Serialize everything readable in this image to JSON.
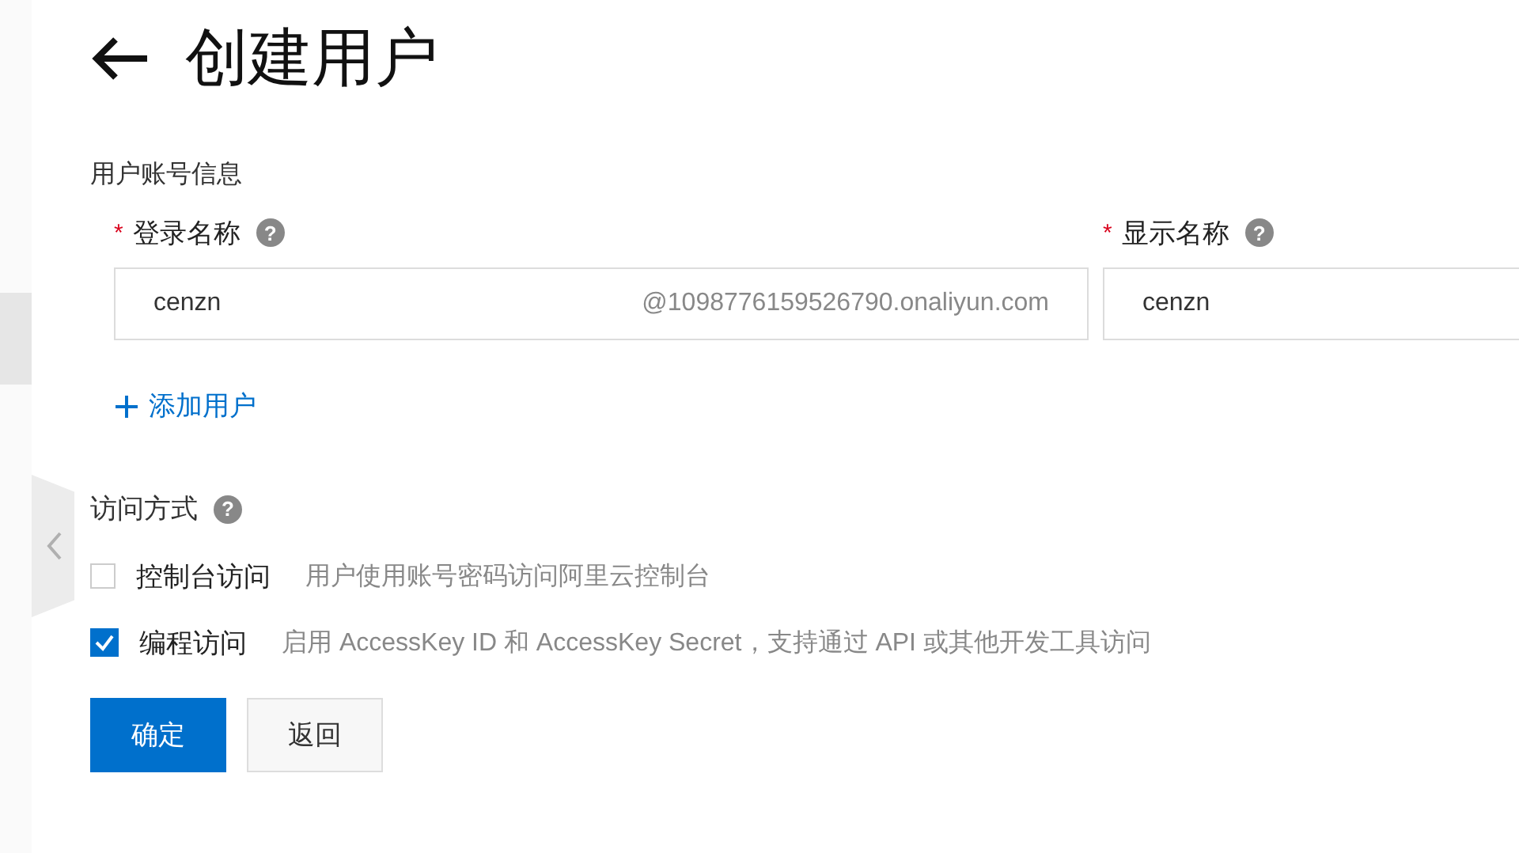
{
  "title": "创建用户",
  "account_section": {
    "heading": "用户账号信息",
    "fields": [
      {
        "required_mark": "*",
        "label": "登录名称",
        "help": "?",
        "value": "cenzn",
        "suffix": "@1098776159526790.onaliyun.com"
      },
      {
        "required_mark": "*",
        "label": "显示名称",
        "help": "?",
        "value": "cenzn"
      }
    ],
    "add_user": {
      "label": "添加用户"
    }
  },
  "access_section": {
    "heading": "访问方式",
    "help": "?",
    "options": [
      {
        "label": "控制台访问",
        "description": "用户使用账号密码访问阿里云控制台",
        "checked": false
      },
      {
        "label": "编程访问",
        "description": "启用 AccessKey ID 和 AccessKey Secret，支持通过 API 或其他开发工具访问",
        "checked": true
      }
    ]
  },
  "buttons": [
    {
      "label": "确定",
      "kind": "primary"
    },
    {
      "label": "返回",
      "kind": "default"
    }
  ]
}
